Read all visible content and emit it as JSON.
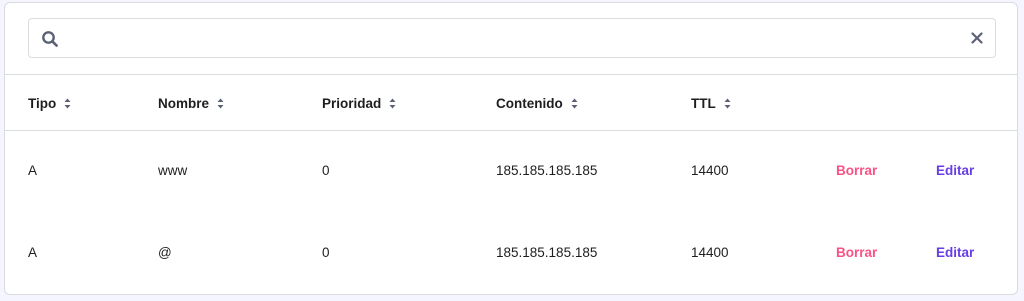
{
  "search": {
    "value": "",
    "placeholder": ""
  },
  "table": {
    "columns": [
      "Tipo",
      "Nombre",
      "Prioridad",
      "Contenido",
      "TTL"
    ],
    "rows": [
      {
        "tipo": "A",
        "nombre": "www",
        "prioridad": "0",
        "contenido": "185.185.185.185",
        "ttl": "14400",
        "delete_label": "Borrar",
        "edit_label": "Editar"
      },
      {
        "tipo": "A",
        "nombre": "@",
        "prioridad": "0",
        "contenido": "185.185.185.185",
        "ttl": "14400",
        "delete_label": "Borrar",
        "edit_label": "Editar"
      }
    ]
  },
  "colors": {
    "delete": "#fc5185",
    "edit": "#673de6",
    "text": "#1d1e20",
    "icon": "#5b6276"
  },
  "icons": {
    "search": "search-icon",
    "clear": "close-icon",
    "sort": "sort-icon"
  }
}
